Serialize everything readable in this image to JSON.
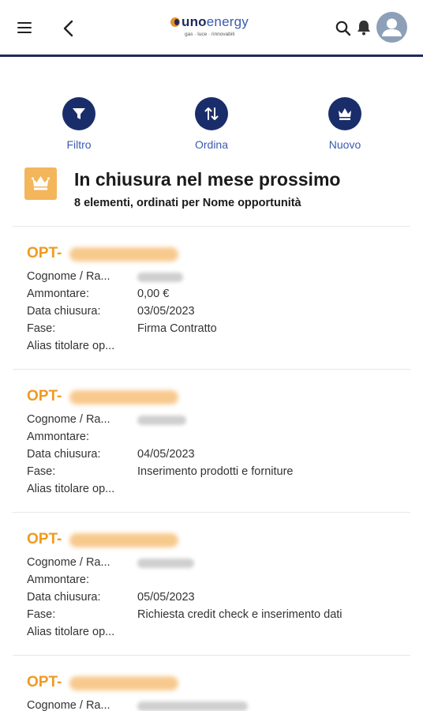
{
  "header": {
    "logo_main": "uno",
    "logo_main_light": "energy",
    "logo_tagline": "gas · luce · rinnovabili",
    "icons": [
      "hamburger-icon",
      "back-icon",
      "search-icon",
      "bell-icon",
      "user-icon"
    ]
  },
  "actions": [
    {
      "label": "Filtro",
      "icon": "filter-icon"
    },
    {
      "label": "Ordina",
      "icon": "sort-icon"
    },
    {
      "label": "Nuovo",
      "icon": "crown-icon"
    }
  ],
  "list": {
    "title": "In chiusura nel mese prossimo",
    "subtitle": "8 elementi, ordinati per Nome opportunità",
    "icon": "crown-icon"
  },
  "field_labels": {
    "surname": "Cognome / Ra...",
    "amount": "Ammontare:",
    "close_date": "Data chiusura:",
    "stage": "Fase:",
    "alias": "Alias titolare op..."
  },
  "records": [
    {
      "prefix": "OPT-",
      "amount": "0,00 €",
      "close_date": "03/05/2023",
      "stage": "Firma Contratto"
    },
    {
      "prefix": "OPT-",
      "amount": "",
      "close_date": "04/05/2023",
      "stage": "Inserimento prodotti e forniture"
    },
    {
      "prefix": "OPT-",
      "amount": "",
      "close_date": "05/05/2023",
      "stage": "Richiesta credit check e inserimento dati"
    },
    {
      "prefix": "OPT-"
    }
  ],
  "colors": {
    "brand_navy": "#1a2d6b",
    "accent_orange": "#ef9a22",
    "list_icon_bg": "#f4b65b",
    "link_blue": "#3b5bb0"
  }
}
